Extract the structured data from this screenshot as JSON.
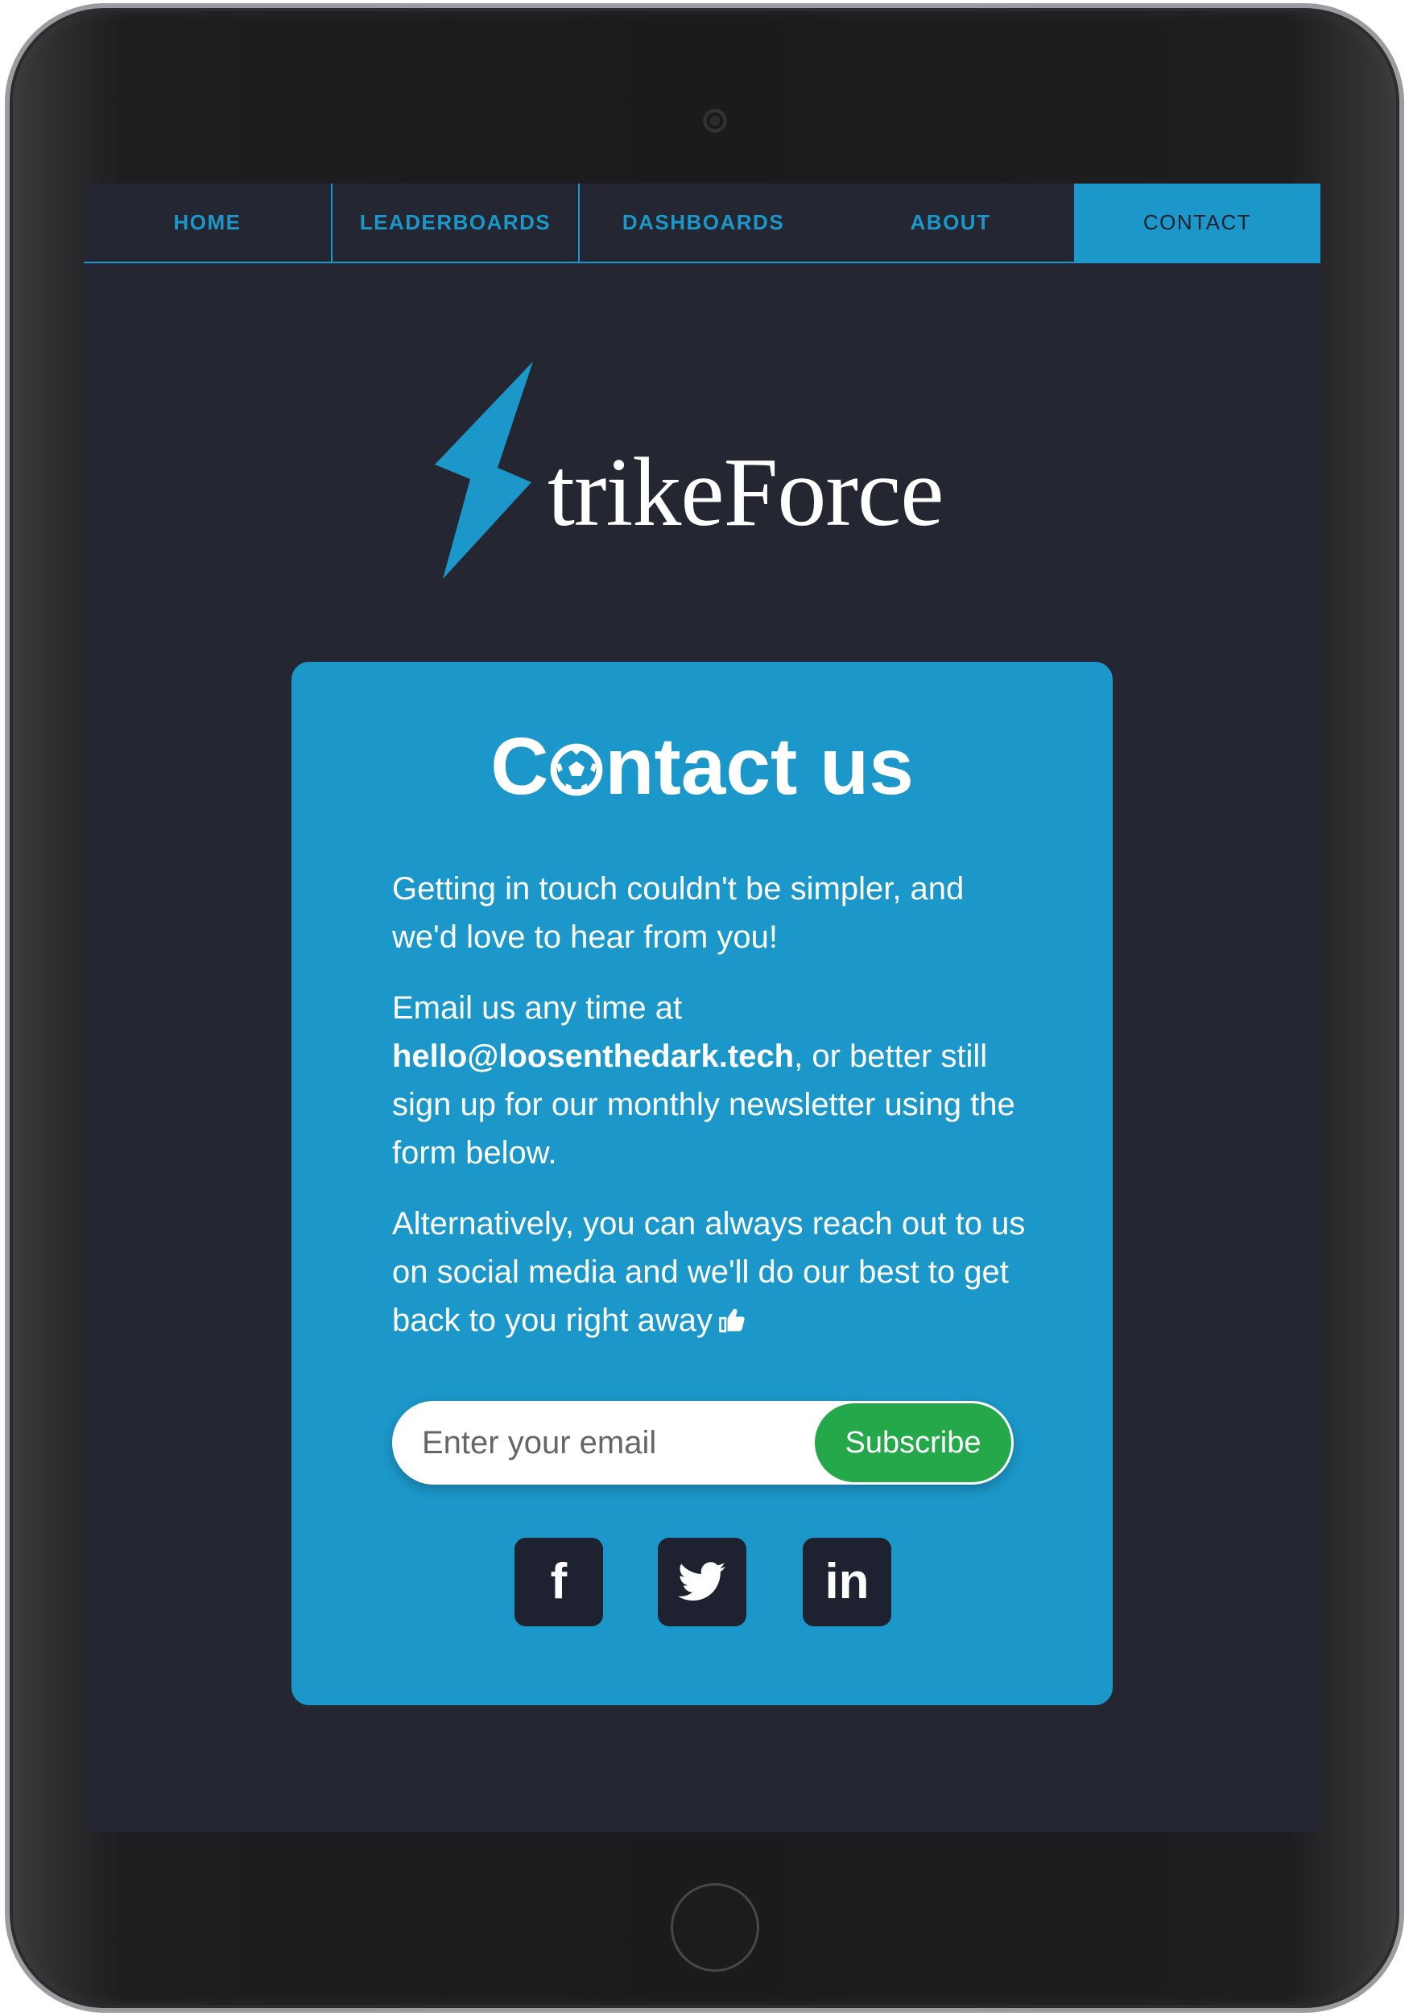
{
  "nav": {
    "items": [
      {
        "label": "HOME"
      },
      {
        "label": "LEADERBOARDS"
      },
      {
        "label": "DASHBOARDS"
      },
      {
        "label": "ABOUT"
      },
      {
        "label": "CONTACT",
        "active": true
      }
    ]
  },
  "logo": {
    "text": "trikeForce",
    "bolt_color": "#1b97c9"
  },
  "contact": {
    "title_before": "C",
    "title_icon": "soccer-ball-icon",
    "title_after": "ntact us",
    "para1": "Getting in touch couldn't be simpler, and we'd love to hear from you!",
    "para2_prefix": "Email us any time at ",
    "email": "hello@loosenthedark.tech",
    "para2_suffix": ", or better still sign up for our monthly newsletter using the form below.",
    "para3": "Alternatively, you can always reach out to us on social media and we'll do our best to get back to you right away",
    "para3_icon": "thumbs-up-icon"
  },
  "subscribe": {
    "placeholder": "Enter your email",
    "value": "",
    "button_label": "Subscribe"
  },
  "social": {
    "facebook_glyph": "f",
    "linkedin_glyph": "in",
    "icons": [
      "facebook-icon",
      "twitter-icon",
      "linkedin-icon"
    ]
  },
  "colors": {
    "accent": "#1b97c9",
    "page_bg": "#242632",
    "subscribe_button": "#25a84a",
    "social_tile": "#1d2130"
  }
}
